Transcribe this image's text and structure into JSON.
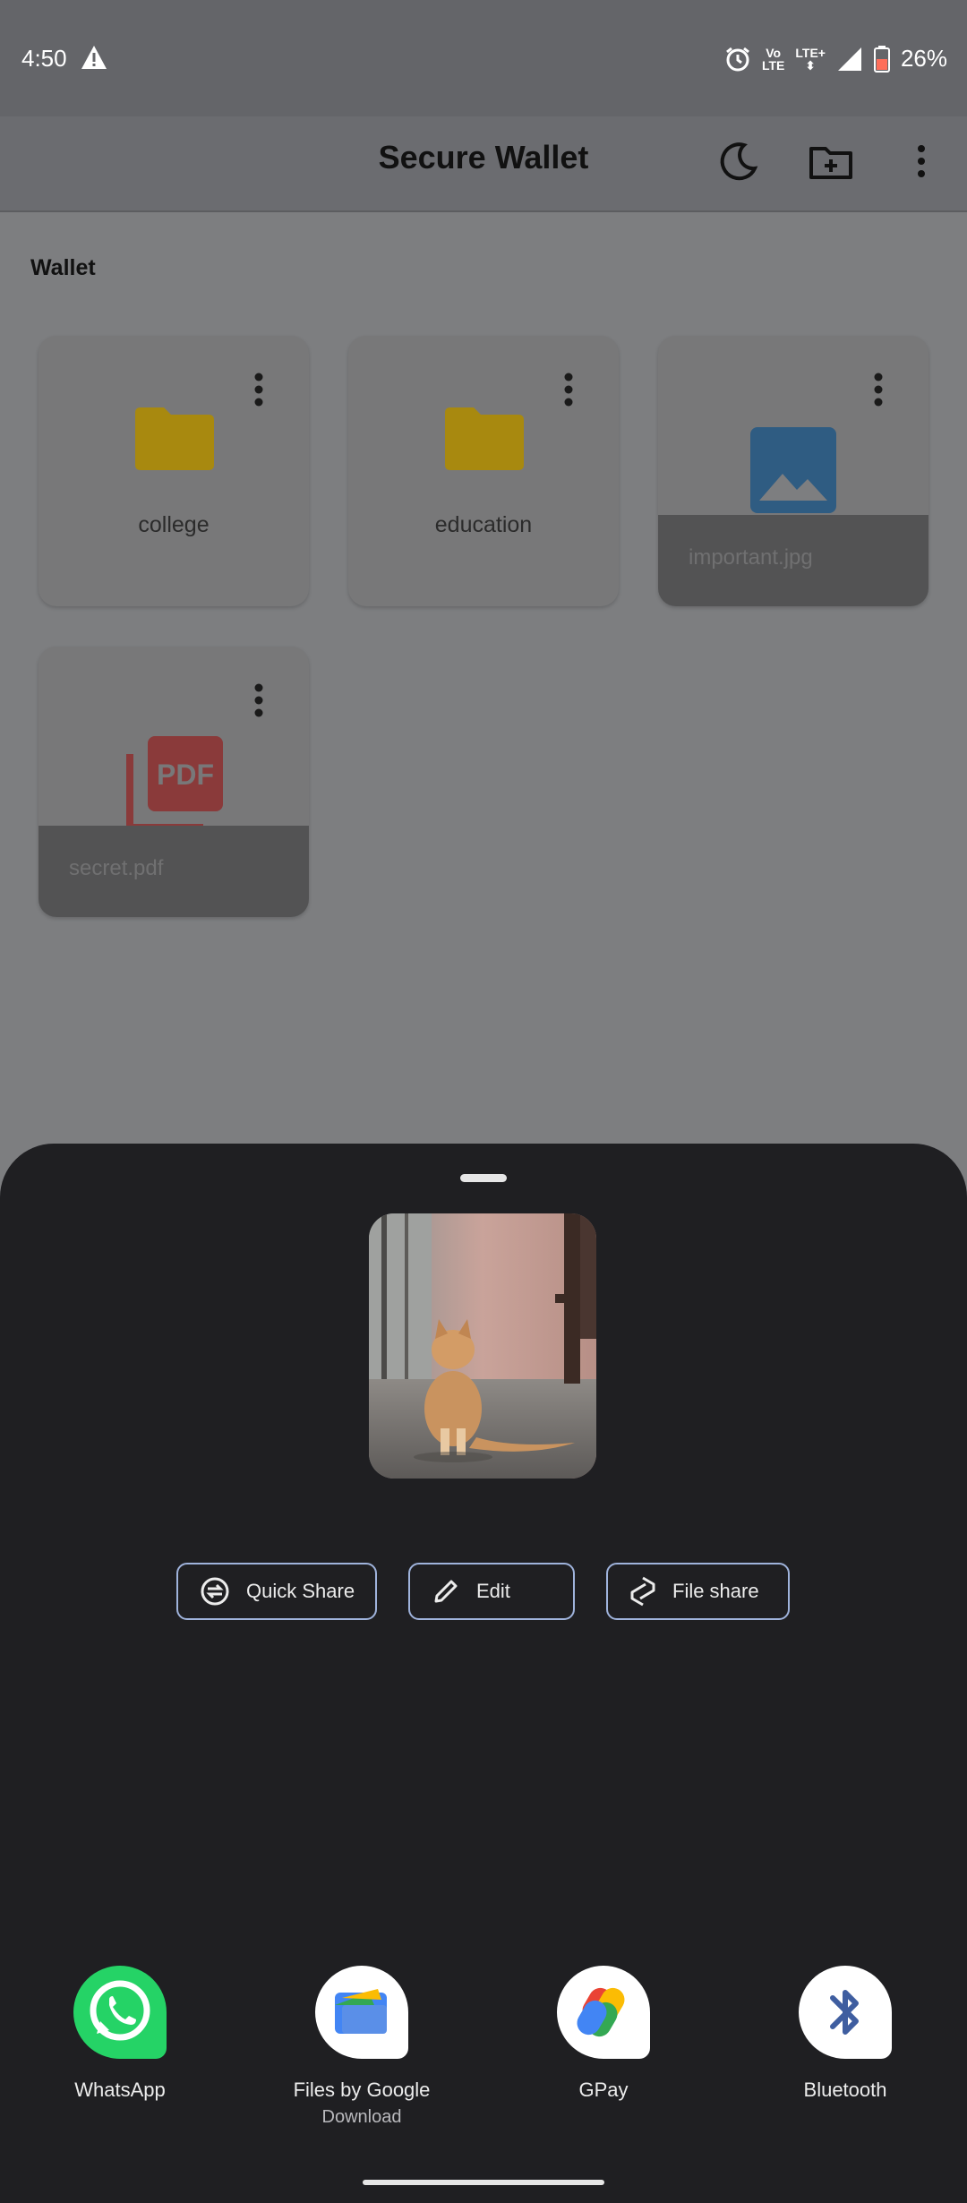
{
  "status_bar": {
    "time": "4:50",
    "volte_top": "Vo",
    "volte_bottom": "LTE",
    "lte_plus": "LTE+",
    "battery": "26%"
  },
  "app_bar": {
    "title": "Secure Wallet",
    "icons": [
      "dark-mode-moon-icon",
      "new-folder-icon",
      "overflow-menu-icon"
    ]
  },
  "wallet": {
    "section_label": "Wallet",
    "items": [
      {
        "name": "college",
        "type": "folder"
      },
      {
        "name": "education",
        "type": "folder"
      },
      {
        "name": "important.jpg",
        "type": "image"
      },
      {
        "name": "secret.pdf",
        "type": "pdf"
      }
    ]
  },
  "share_sheet": {
    "actions": [
      {
        "label": "Quick Share",
        "icon": "quick-share-icon"
      },
      {
        "label": "Edit",
        "icon": "pencil-icon"
      },
      {
        "label": "File share",
        "icon": "file-share-icon"
      }
    ],
    "targets": [
      {
        "label": "WhatsApp",
        "sublabel": ""
      },
      {
        "label": "Files by Google",
        "sublabel": "Download"
      },
      {
        "label": "GPay",
        "sublabel": ""
      },
      {
        "label": "Bluetooth",
        "sublabel": ""
      }
    ],
    "pdf_badge": "PDF"
  },
  "colors": {
    "sheet_bg": "#1f1f22",
    "button_border": "#9fb3dc",
    "folder_yellow": "#a8890f",
    "image_blue": "#2f5c82",
    "pdf_red": "#8a3a3a",
    "whatsapp_green": "#25d366"
  }
}
